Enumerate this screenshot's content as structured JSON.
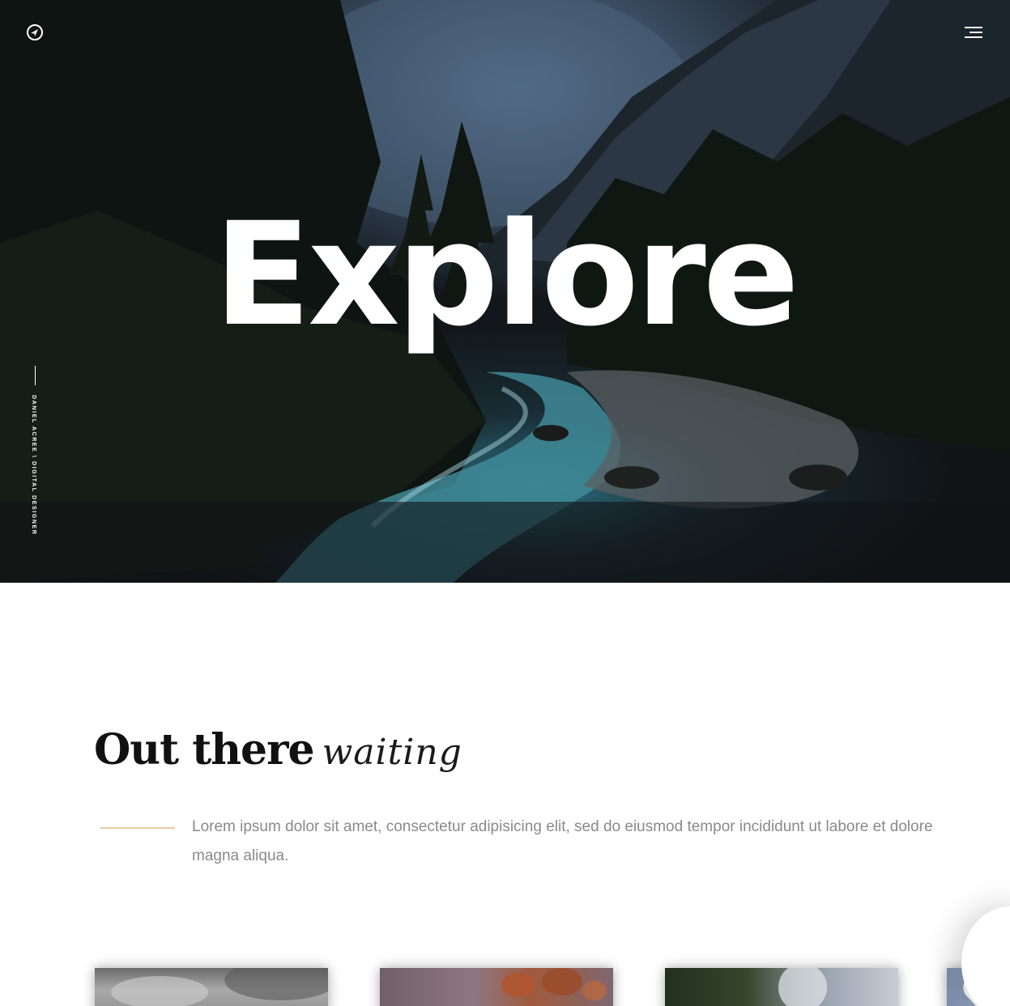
{
  "hero": {
    "title": "Explore",
    "side_caption": "DANIEL ACREE \\ DIGITAL DESIGNER",
    "logo_icon": "compass-arrow-icon",
    "menu_icon": "hamburger-menu-icon"
  },
  "intro": {
    "heading": "Out there",
    "heading_script": "waiting",
    "lead": "Lorem ipsum dolor sit amet, consectetur adipisicing elit, sed do eiusmod tempor incididunt ut labore et dolore magna aliqua."
  },
  "cards": [
    {
      "name": "cloudy-sky"
    },
    {
      "name": "autumn-leaves"
    },
    {
      "name": "misty-waterfall"
    },
    {
      "name": "heart-logo"
    }
  ],
  "colors": {
    "accent_rule": "#e8c9a4",
    "hero_bg": "#12161a",
    "body_text": "#8a8a8a",
    "heading_text": "#111111"
  }
}
